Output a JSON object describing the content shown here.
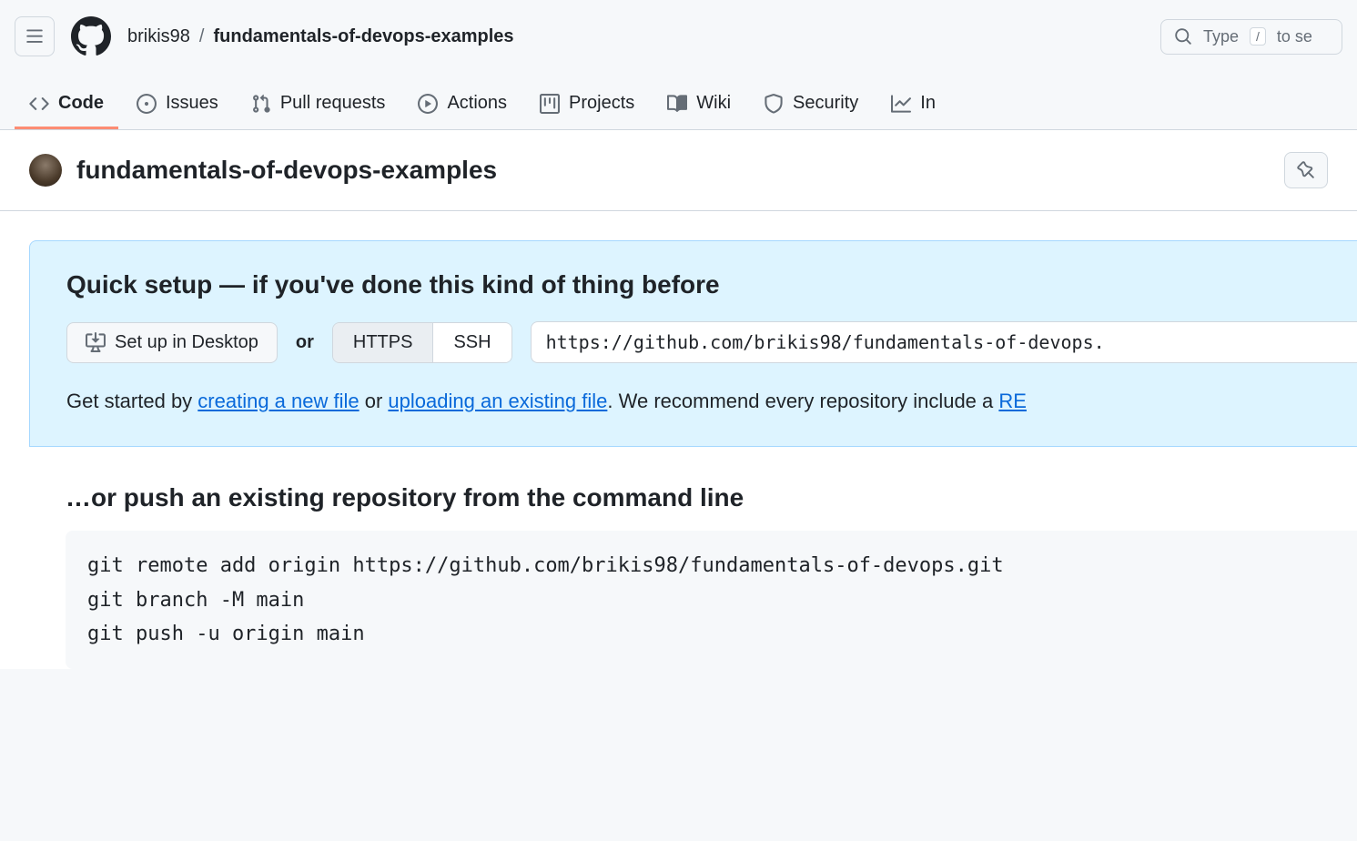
{
  "header": {
    "owner": "brikis98",
    "repo": "fundamentals-of-devops-examples",
    "search_prefix": "Type ",
    "search_key": "/",
    "search_suffix": " to se"
  },
  "tabs": [
    {
      "label": "Code"
    },
    {
      "label": "Issues"
    },
    {
      "label": "Pull requests"
    },
    {
      "label": "Actions"
    },
    {
      "label": "Projects"
    },
    {
      "label": "Wiki"
    },
    {
      "label": "Security"
    },
    {
      "label": "In"
    }
  ],
  "repo_title": "fundamentals-of-devops-examples",
  "quick_setup": {
    "heading": "Quick setup — if you've done this kind of thing before",
    "desktop_label": "Set up in Desktop",
    "or": "or",
    "https": "HTTPS",
    "ssh": "SSH",
    "url": "https://github.com/brikis98/fundamentals-of-devops.",
    "help_prefix": "Get started by ",
    "help_link1": "creating a new file",
    "help_mid": " or ",
    "help_link2": "uploading an existing file",
    "help_suffix": ". We recommend every repository include a ",
    "help_link3": "RE"
  },
  "push": {
    "heading": "…or push an existing repository from the command line",
    "code": "git remote add origin https://github.com/brikis98/fundamentals-of-devops.git\ngit branch -M main\ngit push -u origin main"
  }
}
